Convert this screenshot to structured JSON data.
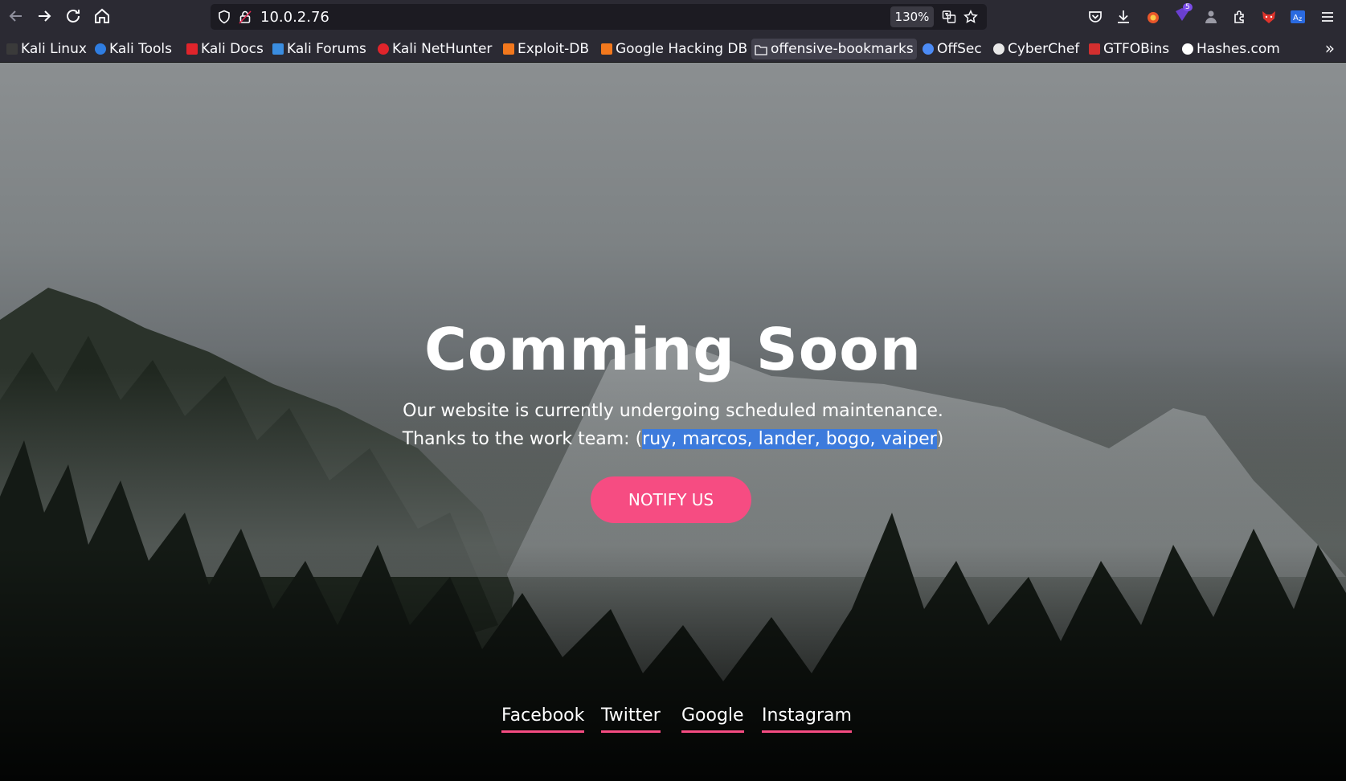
{
  "browser": {
    "url": "10.0.2.76",
    "zoom": "130%",
    "extension_badge": "5"
  },
  "bookmarks": [
    {
      "label": "Kali Linux",
      "color": "#3a3a3a"
    },
    {
      "label": "Kali Tools",
      "color": "#2f7de1"
    },
    {
      "label": "Kali Docs",
      "color": "#e0242b"
    },
    {
      "label": "Kali Forums",
      "color": "#3a8de0"
    },
    {
      "label": "Kali NetHunter",
      "color": "#e0242b"
    },
    {
      "label": "Exploit-DB",
      "color": "#f2781d"
    },
    {
      "label": "Google Hacking DB",
      "color": "#f2781d"
    },
    {
      "label": "offensive-bookmarks",
      "color": "folder"
    },
    {
      "label": "OffSec",
      "color": "#4c8bf5"
    },
    {
      "label": "CyberChef",
      "color": "#e8e8e8"
    },
    {
      "label": "GTFOBins",
      "color": "#d32f2f"
    },
    {
      "label": "Hashes.com",
      "color": "#ffffff"
    }
  ],
  "hero": {
    "title": "Comming Soon",
    "line1": "Our website is currently undergoing scheduled maintenance.",
    "line2_prefix": "Thanks to the work team: (",
    "line2_selected": "ruy, marcos, lander, bogo, vaiper",
    "line2_suffix": ")",
    "button": "NOTIFY US"
  },
  "social": [
    "Facebook",
    "Twitter",
    "Google",
    "Instagram"
  ],
  "colors": {
    "accent": "#f64c82",
    "selection": "#3d7bdc",
    "toolbar": "#2b2a33"
  }
}
